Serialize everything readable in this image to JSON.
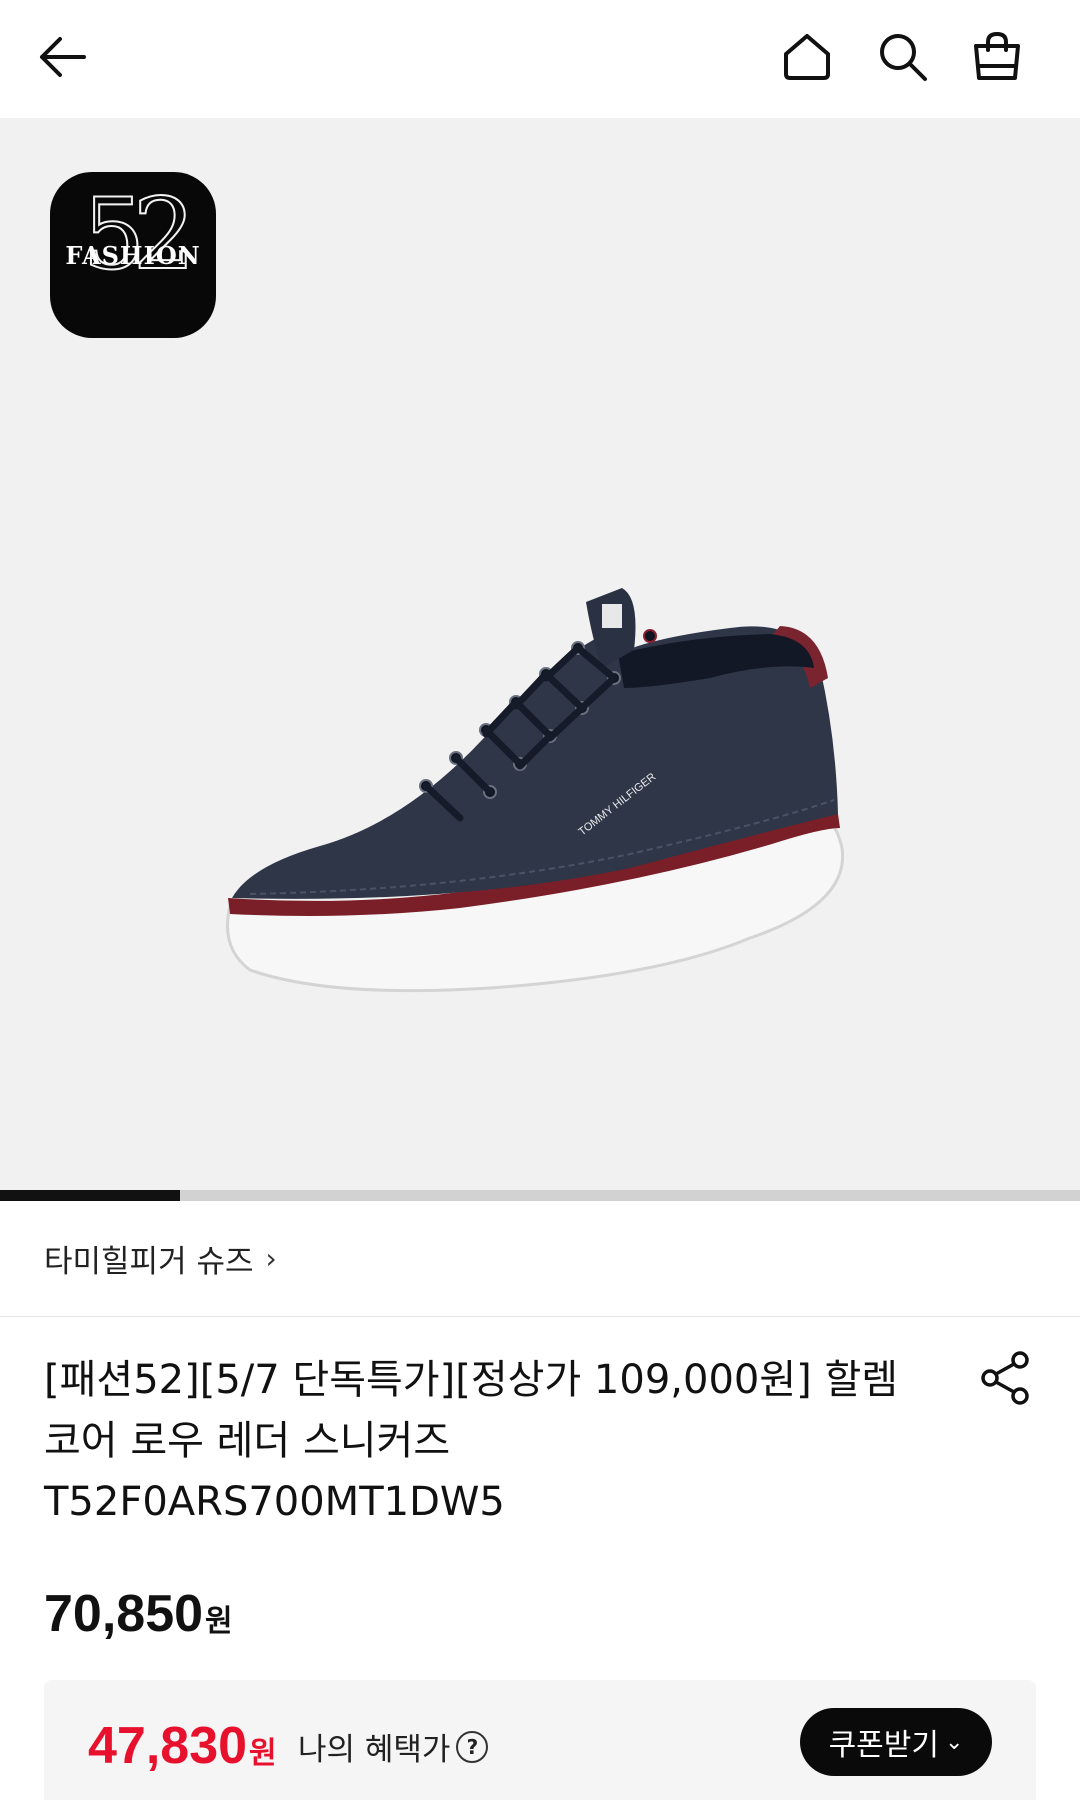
{
  "header": {
    "back_icon": "arrow-left-icon",
    "home_icon": "home-icon",
    "search_icon": "search-icon",
    "cart_icon": "shopping-bag-icon"
  },
  "hero": {
    "badge_word": "FASHION",
    "badge_number": "52",
    "image_progress": 0.167
  },
  "brand": {
    "label": "타미힐피거 슈즈",
    "chevron": "›"
  },
  "product": {
    "title_line1": "[패션52][5/7 단독특가][정상가 109,000원] 할렘",
    "title_line2": "코어 로우 레더 스니커즈",
    "title_line3": "T52F0ARS700MT1DW5",
    "share_icon": "share-icon"
  },
  "price": {
    "value": "70,850",
    "unit": "원"
  },
  "benefit": {
    "value": "47,830",
    "unit": "원",
    "label": "나의 혜택가",
    "help": "?",
    "coupon_label": "쿠폰받기",
    "coupon_chevron": "⌄"
  },
  "colors": {
    "accent_red": "#e8112d",
    "hero_bg": "#f1f1f1",
    "dark": "#0a0a0a"
  }
}
